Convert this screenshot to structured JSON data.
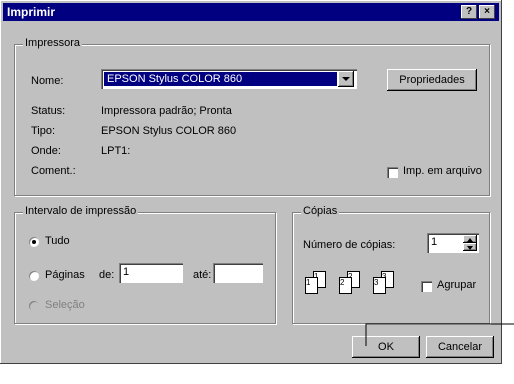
{
  "window": {
    "title": "Imprimir",
    "help_glyph": "?",
    "close_glyph": "×"
  },
  "printer_group": {
    "legend": "Impressora",
    "name_label": "Nome:",
    "name_value": "EPSON Stylus COLOR 860",
    "properties_button": "Propriedades",
    "status_label": "Status:",
    "status_value": "Impressora padrão; Pronta",
    "type_label": "Tipo:",
    "type_value": "EPSON Stylus COLOR 860",
    "where_label": "Onde:",
    "where_value": "LPT1:",
    "comment_label": "Coment.:",
    "print_to_file_label": "Imp. em arquivo"
  },
  "range_group": {
    "legend": "Intervalo de impressão",
    "all_label": "Tudo",
    "pages_label": "Páginas",
    "from_label": "de:",
    "from_value": "1",
    "to_label": "até:",
    "to_value": "",
    "selection_label": "Seleção"
  },
  "copies_group": {
    "legend": "Cópias",
    "num_copies_label": "Número de cópias:",
    "num_copies_value": "1",
    "collate_label": "Agrupar",
    "collate_icons": [
      {
        "back": "1",
        "front": "1"
      },
      {
        "back": "2",
        "front": "2"
      },
      {
        "back": "3",
        "front": "3"
      }
    ]
  },
  "buttons": {
    "ok": "OK",
    "cancel": "Cancelar"
  }
}
